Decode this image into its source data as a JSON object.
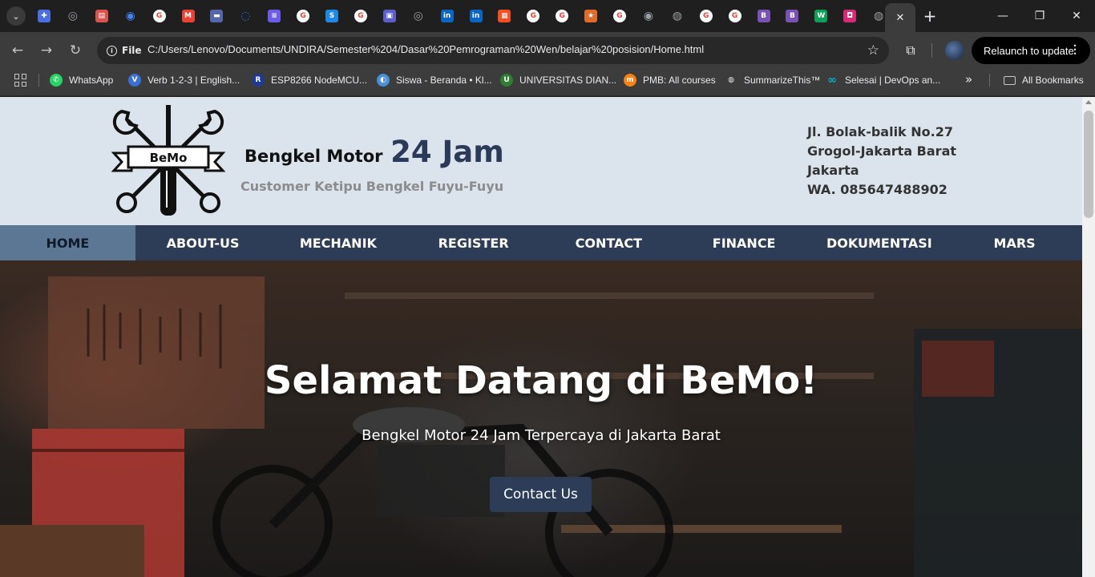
{
  "browser": {
    "tabs": [
      {
        "icon": "tab-menu-icon"
      },
      {
        "icon": "puzzle-app-icon",
        "color": "#4a6ee0"
      },
      {
        "icon": "chatgpt-icon",
        "color": "#9aa0a6"
      },
      {
        "icon": "document-icon",
        "color": "#d9534f"
      },
      {
        "icon": "google-lens-icon",
        "color": "#4285f4"
      },
      {
        "icon": "google-icon",
        "color": "#ea4335"
      },
      {
        "icon": "gmail-icon",
        "color": "#ea4335"
      },
      {
        "icon": "site-icon",
        "color": "#5566aa"
      },
      {
        "icon": "sync-icon",
        "color": "#1a73e8"
      },
      {
        "icon": "list-icon",
        "color": "#6c5ce7"
      },
      {
        "icon": "google-icon",
        "color": "#ea4335"
      },
      {
        "icon": "s-icon",
        "color": "#1e88e5"
      },
      {
        "icon": "google-icon",
        "color": "#ea4335"
      },
      {
        "icon": "teams-icon",
        "color": "#5b5fc7"
      },
      {
        "icon": "chatgpt-icon",
        "color": "#9aa0a6"
      },
      {
        "icon": "linkedin-icon",
        "color": "#0a66c2"
      },
      {
        "icon": "linkedin-icon",
        "color": "#0a66c2"
      },
      {
        "icon": "microsoft-icon",
        "color": "#f25022"
      },
      {
        "icon": "google-icon",
        "color": "#ea4335"
      },
      {
        "icon": "google-icon",
        "color": "#ea4335"
      },
      {
        "icon": "star-app-icon",
        "color": "#e06c2c"
      },
      {
        "icon": "google-icon",
        "color": "#ea4335"
      },
      {
        "icon": "chrome-icon",
        "color": "#9aa0a6"
      },
      {
        "icon": "globe-icon",
        "color": "#9aa0a6"
      },
      {
        "icon": "google-icon",
        "color": "#ea4335"
      },
      {
        "icon": "google-icon",
        "color": "#ea4335"
      },
      {
        "icon": "bootstrap-icon",
        "color": "#7952b3"
      },
      {
        "icon": "bootstrap-icon",
        "color": "#7952b3"
      },
      {
        "icon": "w-icon",
        "color": "#0f9d58"
      },
      {
        "icon": "instagram-icon",
        "color": "#d62976"
      },
      {
        "icon": "globe-icon",
        "color": "#9aa0a6"
      }
    ],
    "fav_letters": {
      "s": "S",
      "linkedin": "in",
      "bootstrap": "B",
      "w": "W",
      "microsoft": "",
      "google": "G"
    },
    "active_tab_close": "✕",
    "new_tab": "+",
    "window": {
      "minimize": "—",
      "maximize": "❐",
      "close": "✕"
    },
    "nav": {
      "back": "←",
      "forward": "→",
      "reload": "↻"
    },
    "site_chip": "File",
    "url": "C:/Users/Lenovo/Documents/UNDIRA/Semester%204/Dasar%20Pemrograman%20Wen/belajar%20posision/Home.html",
    "relaunch": "Relaunch to update",
    "bookmarks": [
      {
        "label": "WhatsApp",
        "icon": "whatsapp-icon",
        "color": "#25d366"
      },
      {
        "label": "Verb 1-2-3 | English...",
        "icon": "verb-site-icon",
        "color": "#3b6fd1"
      },
      {
        "label": "ESP8266 NodeMCU...",
        "icon": "r-icon",
        "color": "#1f3a93"
      },
      {
        "label": "Siswa - Beranda • Kl...",
        "icon": "classroom-icon",
        "color": "#4a90d9"
      },
      {
        "label": "UNIVERSITAS DIAN...",
        "icon": "university-icon",
        "color": "#2e7d32"
      },
      {
        "label": "PMB: All courses",
        "icon": "moodle-icon",
        "color": "#f98012"
      },
      {
        "label": "SummarizeThis™",
        "icon": "globe-icon",
        "color": "#e8eaed"
      },
      {
        "label": "Selesai | DevOps an...",
        "icon": "infinity-icon",
        "color": "#00b3c7"
      }
    ],
    "bookmarks_more": "»",
    "all_bookmarks": "All Bookmarks"
  },
  "site": {
    "brand": {
      "name": "Bengkel Motor",
      "highlight": "24 Jam",
      "tagline": "Customer Ketipu Bengkel Fuyu-Fuyu",
      "logo_text": "BeMo"
    },
    "address": [
      "Jl. Bolak-balik No.27",
      "Grogol-Jakarta Barat",
      "Jakarta",
      "WA. 085647488902"
    ],
    "nav": [
      "HOME",
      "ABOUT-US",
      "MECHANIK",
      "REGISTER",
      "CONTACT",
      "FINANCE",
      "DOKUMENTASI",
      "MARS"
    ],
    "hero": {
      "title": "Selamat Datang di BeMo!",
      "subtitle": "Bengkel Motor 24 Jam Terpercaya di Jakarta Barat",
      "button": "Contact Us"
    }
  },
  "colors": {
    "header_bg": "#dbe3ec",
    "nav_bg": "#2d3c57",
    "nav_active": "#5b7793",
    "button_bg": "#2d3c57"
  }
}
